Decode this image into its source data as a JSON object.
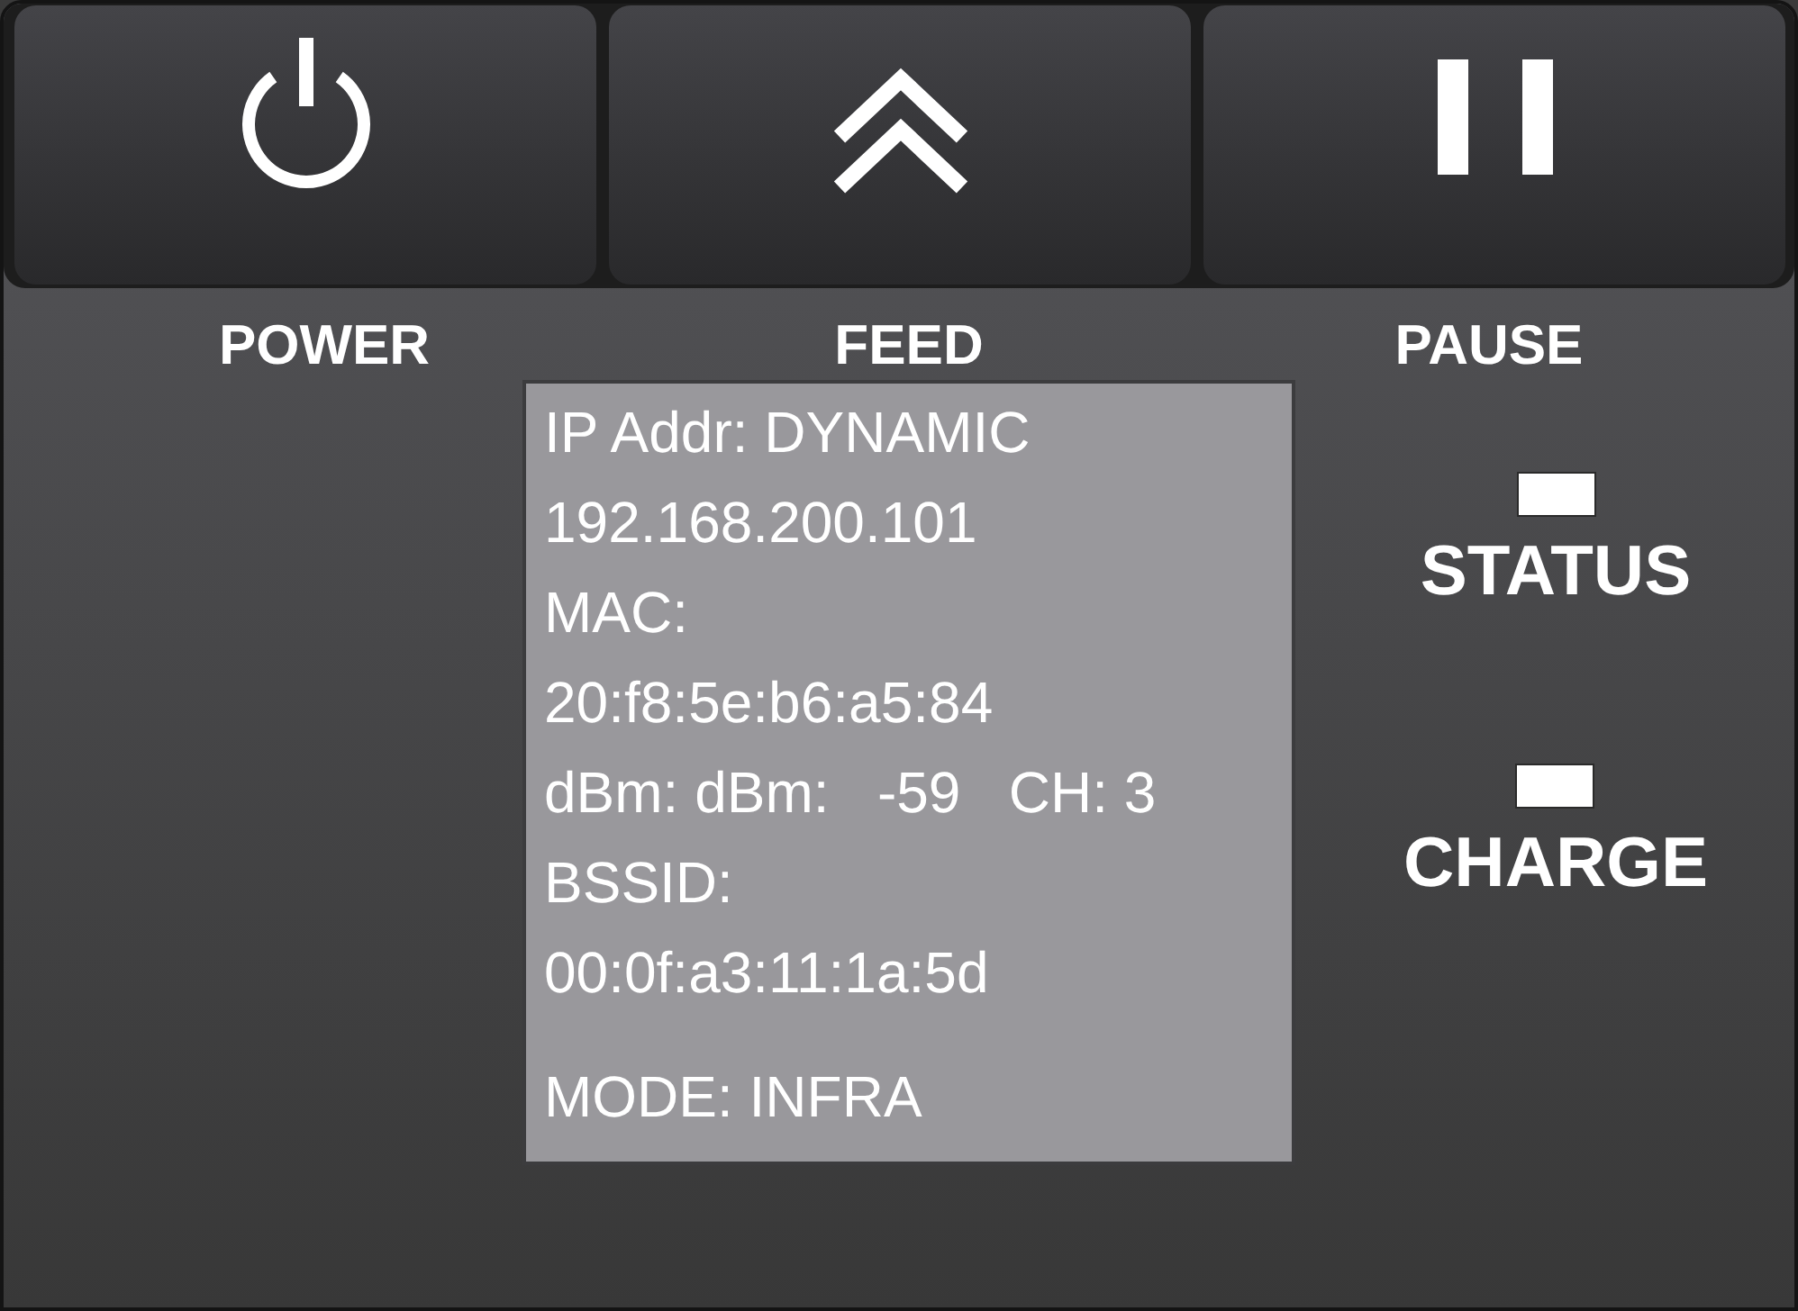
{
  "buttons": [
    {
      "kind": "power",
      "label": "POWER"
    },
    {
      "kind": "feed",
      "label": "FEED"
    },
    {
      "kind": "pause",
      "label": "PAUSE"
    }
  ],
  "display": {
    "lines": [
      "IP Addr: DYNAMIC",
      "192.168.200.101",
      "MAC:",
      "20:f8:5e:b6:a5:84",
      "dBm: dBm:   -59   CH: 3",
      "BSSID:",
      "00:0f:a3:11:1a:5d"
    ],
    "footer": "MODE: INFRA"
  },
  "indicators": [
    {
      "label": "STATUS"
    },
    {
      "label": "CHARGE"
    }
  ]
}
